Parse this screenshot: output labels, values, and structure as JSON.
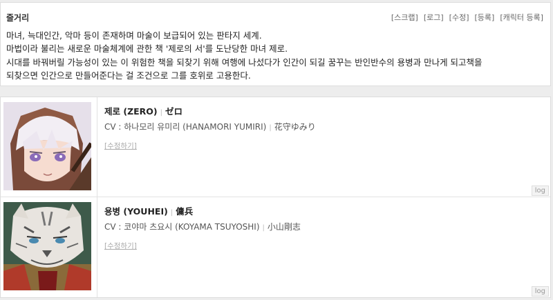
{
  "synopsis": {
    "title": "줄거리",
    "links": [
      "[스크랩]",
      "[로그]",
      "[수정]",
      "[등록]",
      "[캐릭터 등록]"
    ],
    "lines": [
      "마녀, 늑대인간, 악마 등이 존재하며 마술이 보급되어 있는 판타지 세계.",
      "마법이라 불리는 새로운 마술체계에 관한 책 '제로의 서'를 도난당한 마녀 제로.",
      "시대를 바꿔버릴 가능성이 있는 이 위험한 책을 되찾기 위해 여행에 나섰다가 인간이 되길 꿈꾸는 반인반수의 용병과 만나게 되고책을",
      "되찾으면 인간으로 만들어준다는 걸 조건으로 그를 호위로 고용한다."
    ]
  },
  "characters": [
    {
      "name": "제로 (ZERO)",
      "name_jp": "ゼロ",
      "cv_label": "CV : 하나모리 유미리 (HANAMORI YUMIRI)",
      "cv_jp": "花守ゆみり",
      "edit": "[수정하기]",
      "log": "log",
      "portrait_icon": "zero-portrait"
    },
    {
      "name": "용병 (YOUHEI)",
      "name_jp": "傭兵",
      "cv_label": "CV : 코야마 츠요시 (KOYAMA TSUYOSHI)",
      "cv_jp": "小山剛志",
      "edit": "[수정하기]",
      "log": "log",
      "portrait_icon": "mercenary-portrait"
    }
  ],
  "separator": "|"
}
